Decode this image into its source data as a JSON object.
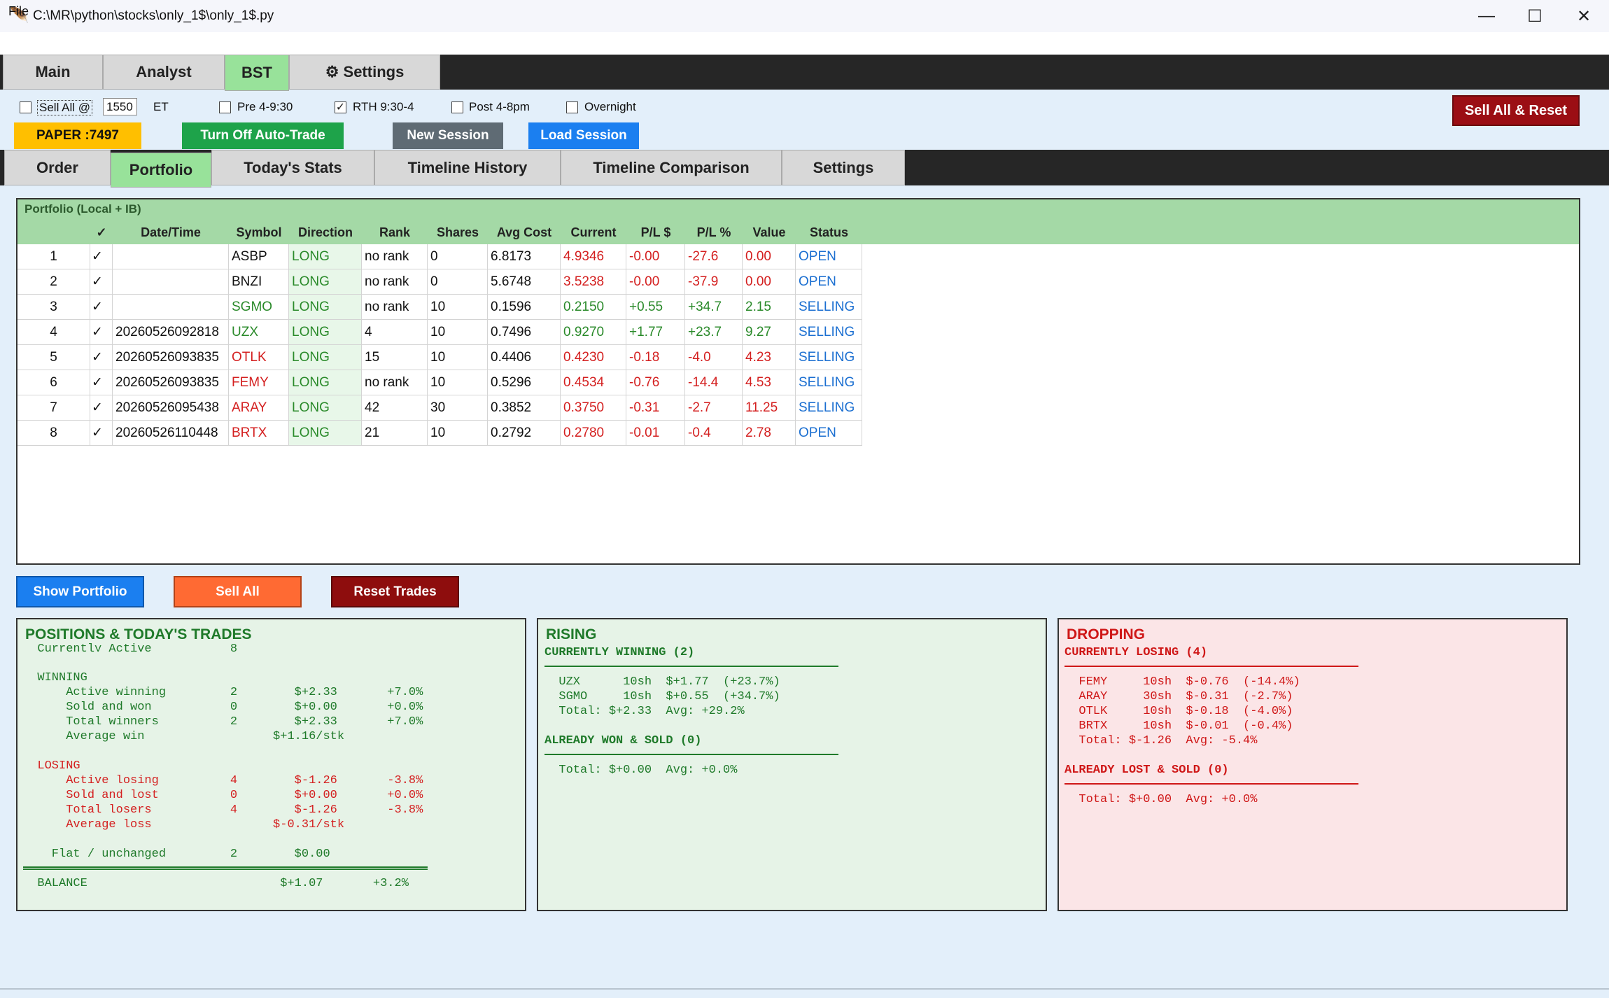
{
  "window": {
    "title": "C:\\MR\\python\\stocks\\only_1$\\only_1$.py",
    "minimize": "—",
    "maximize": "☐",
    "close": "✕"
  },
  "menu": {
    "file": "File"
  },
  "main_tabs": [
    {
      "label": "Main"
    },
    {
      "label": "Analyst"
    },
    {
      "label": "BST"
    },
    {
      "label": "⚙ Settings"
    }
  ],
  "controls": {
    "sell_all_label": "Sell All @",
    "sell_all_time": "1550",
    "et_label": "ET",
    "pre_label": "Pre 4-9:30",
    "rth_label": "RTH 9:30-4",
    "post_label": "Post 4-8pm",
    "overnight_label": "Overnight",
    "rth_checked": "✓",
    "sell_reset_button": "Sell All & Reset",
    "paper_badge": "PAPER :7497",
    "auto_trade_button": "Turn Off Auto-Trade",
    "new_session_button": "New Session",
    "load_session_button": "Load Session"
  },
  "sub_tabs": [
    {
      "label": "Order"
    },
    {
      "label": "Portfolio"
    },
    {
      "label": "Today's Stats"
    },
    {
      "label": "Timeline History"
    },
    {
      "label": "Timeline Comparison"
    },
    {
      "label": "Settings"
    }
  ],
  "portfolio": {
    "caption": "Portfolio (Local + IB)",
    "columns": [
      "",
      "✓",
      "Date/Time",
      "Symbol",
      "Direction",
      "Rank",
      "Shares",
      "Avg Cost",
      "Current",
      "P/L $",
      "P/L %",
      "Value",
      "Status"
    ],
    "rows": [
      [
        "1",
        "✓",
        "",
        "ASBP",
        "LONG",
        "no rank",
        "0",
        "6.8173",
        "4.9346",
        "-0.00",
        "-27.6",
        "0.00",
        "OPEN"
      ],
      [
        "2",
        "✓",
        "",
        "BNZI",
        "LONG",
        "no rank",
        "0",
        "5.6748",
        "3.5238",
        "-0.00",
        "-37.9",
        "0.00",
        "OPEN"
      ],
      [
        "3",
        "✓",
        "",
        "SGMO",
        "LONG",
        "no rank",
        "10",
        "0.1596",
        "0.2150",
        "+0.55",
        "+34.7",
        "2.15",
        "SELLING"
      ],
      [
        "4",
        "✓",
        "20260526092818",
        "UZX",
        "LONG",
        "4",
        "10",
        "0.7496",
        "0.9270",
        "+1.77",
        "+23.7",
        "9.27",
        "SELLING"
      ],
      [
        "5",
        "✓",
        "20260526093835",
        "OTLK",
        "LONG",
        "15",
        "10",
        "0.4406",
        "0.4230",
        "-0.18",
        "-4.0",
        "4.23",
        "SELLING"
      ],
      [
        "6",
        "✓",
        "20260526093835",
        "FEMY",
        "LONG",
        "no rank",
        "10",
        "0.5296",
        "0.4534",
        "-0.76",
        "-14.4",
        "4.53",
        "SELLING"
      ],
      [
        "7",
        "✓",
        "20260526095438",
        "ARAY",
        "LONG",
        "42",
        "30",
        "0.3852",
        "0.3750",
        "-0.31",
        "-2.7",
        "11.25",
        "SELLING"
      ],
      [
        "8",
        "✓",
        "20260526110448",
        "BRTX",
        "LONG",
        "21",
        "10",
        "0.2792",
        "0.2780",
        "-0.01",
        "-0.4",
        "2.78",
        "OPEN"
      ]
    ]
  },
  "actions": {
    "show_portfolio": "Show Portfolio",
    "sell_all": "Sell All",
    "reset_trades": "Reset Trades"
  },
  "positions_panel": {
    "title": "POSITIONS & TODAY'S TRADES",
    "clipped_line": "  Currently Active           8",
    "winning_heading": "  WINNING",
    "winning_lines": [
      "      Active winning         2        $+2.33       +7.0%",
      "      Sold and won           0        $+0.00       +0.0%",
      "      Total winners          2        $+2.33       +7.0%",
      "      Average win                  $+1.16/stk"
    ],
    "losing_heading": "  LOSING",
    "losing_lines": [
      "      Active losing          4        $-1.26       -3.8%",
      "      Sold and lost          0        $+0.00       +0.0%",
      "      Total losers           4        $-1.26       -3.8%",
      "      Average loss                 $-0.31/stk"
    ],
    "flat_line": "    Flat / unchanged         2        $0.00",
    "balance_line": "  BALANCE                           $+1.07       +3.2%"
  },
  "rising_panel": {
    "title": "RISING",
    "currently_heading": "CURRENTLY WINNING (2)",
    "lines": [
      "  UZX      10sh  $+1.77  (+23.7%)",
      "  SGMO     10sh  $+0.55  (+34.7%)",
      "  Total: $+2.33  Avg: +29.2%"
    ],
    "sold_heading": "ALREADY WON & SOLD (0)",
    "sold_total": "  Total: $+0.00  Avg: +0.0%"
  },
  "dropping_panel": {
    "title": "DROPPING",
    "currently_heading": "CURRENTLY LOSING (4)",
    "lines": [
      "  FEMY     10sh  $-0.76  (-14.4%)",
      "  ARAY     30sh  $-0.31  (-2.7%)",
      "  OTLK     10sh  $-0.18  (-4.0%)",
      "  BRTX     10sh  $-0.01  (-0.4%)",
      "  Total: $-1.26  Avg: -5.4%"
    ],
    "sold_heading": "ALREADY LOST & SOLD (0)",
    "sold_total": "  Total: $+0.00  Avg: +0.0%"
  },
  "colors": {
    "tab_active": "#98e29a",
    "sell_reset": "#9b0e14",
    "paper": "#ffbf00",
    "auto_trade": "#1ea34a",
    "new_session": "#5f6b74",
    "load_session": "#1b7ff0",
    "show_portfolio": "#1b7ff0",
    "sell_all": "#ff6a33",
    "reset_trades": "#8e0d0d",
    "gain": "#2a8a2a",
    "loss": "#d42020",
    "status": "#1b6fd1"
  }
}
